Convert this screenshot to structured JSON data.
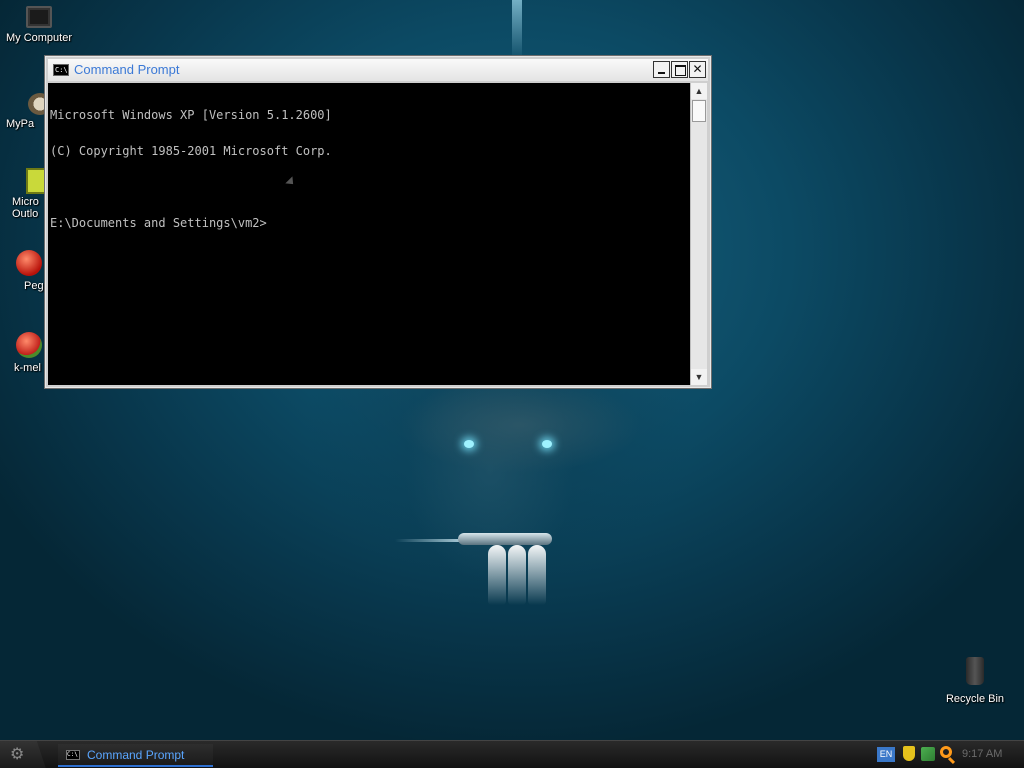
{
  "desktop": {
    "icons": [
      {
        "label": "My Computer",
        "icon": "computer-icon"
      },
      {
        "label": "MyPa",
        "icon": "mypa-icon"
      },
      {
        "label": "Micro\nOutlo",
        "icon": "outlook-icon"
      },
      {
        "label": "Peg",
        "icon": "pegasus-icon"
      },
      {
        "label": "k-mel",
        "icon": "k-meleon-icon"
      },
      {
        "label": "Recycle Bin",
        "icon": "recycle-bin-icon"
      }
    ]
  },
  "window": {
    "title": "Command Prompt",
    "icon_label": "C:\\",
    "console_lines": [
      "Microsoft Windows XP [Version 5.1.2600]",
      "(C) Copyright 1985-2001 Microsoft Corp.",
      "",
      "E:\\Documents and Settings\\vm2>"
    ]
  },
  "taskbar": {
    "task_label": "Command Prompt",
    "task_icon_label": "C:\\",
    "language": "EN",
    "clock": "9:17 AM"
  },
  "colors": {
    "title_text": "#3b79d6",
    "taskbar_active_text": "#5aa6ff",
    "console_bg": "#000000",
    "console_text": "#c0c0c0"
  }
}
